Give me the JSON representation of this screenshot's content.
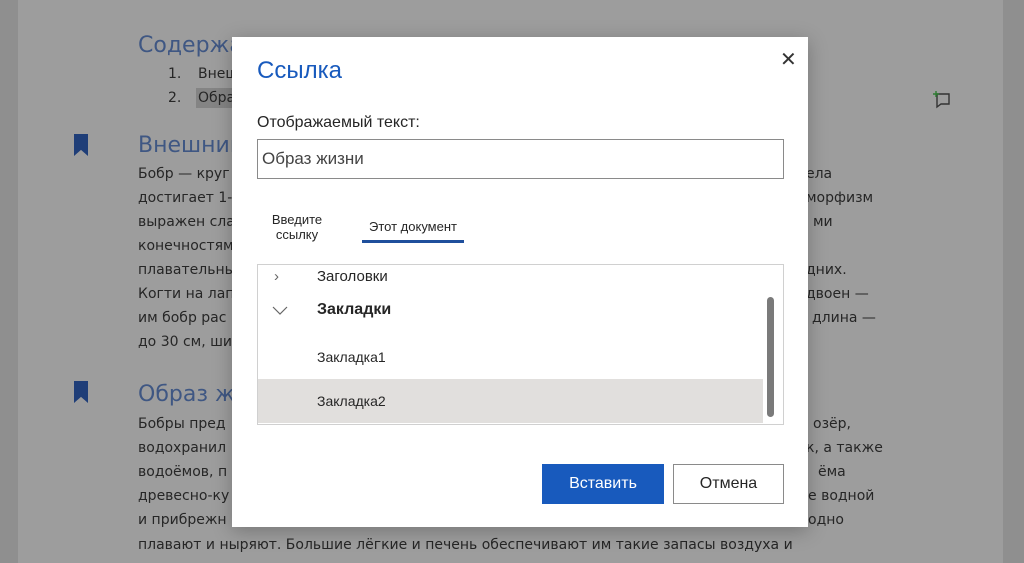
{
  "document": {
    "toc_heading": "Содержа",
    "toc_items": [
      "1.",
      "Внеш",
      "2.",
      "Обра"
    ],
    "heading1": "Внешний",
    "para1_left": [
      "Бобр — круг",
      "достигает 1-",
      "выражен сла",
      "конечностям",
      "плавательны",
      "Когти на лап",
      "им бобр рас",
      "до 30 см, ши"
    ],
    "para1_right": [
      "ела",
      "морфизм",
      "ми",
      "",
      "дних.",
      "двоен —",
      "длина —",
      ""
    ],
    "heading2": "Образ ж",
    "para2_left": [
      "Бобры пред",
      "водохранил",
      "водоёмов, п",
      "древесно-ку",
      "и прибрежн"
    ],
    "para2_right": [
      "озёр,",
      "к, а также",
      "ёма",
      "е водной",
      "одно"
    ],
    "last_line": "плавают и ныряют. Большие лёгкие и печень обеспечивают им такие запасы воздуха и"
  },
  "dialog": {
    "title": "Ссылка",
    "close": "✕",
    "display_text_label": "Отображаемый текст:",
    "display_text_value": "Образ жизни",
    "tabs": [
      {
        "label": "Введите ссылку"
      },
      {
        "label": "Этот документ",
        "active": true
      }
    ],
    "tree": [
      {
        "label": "Заголовки",
        "icon": "chevron-right-icon"
      },
      {
        "label": "Закладки",
        "icon": "chevron-down-icon",
        "expanded": true
      },
      {
        "label": "Закладка1"
      },
      {
        "label": "Закладка2",
        "selected": true
      }
    ],
    "insert": "Вставить",
    "cancel": "Отмена"
  },
  "colors": {
    "accent": "#185abd",
    "heading": "#3f5783"
  }
}
